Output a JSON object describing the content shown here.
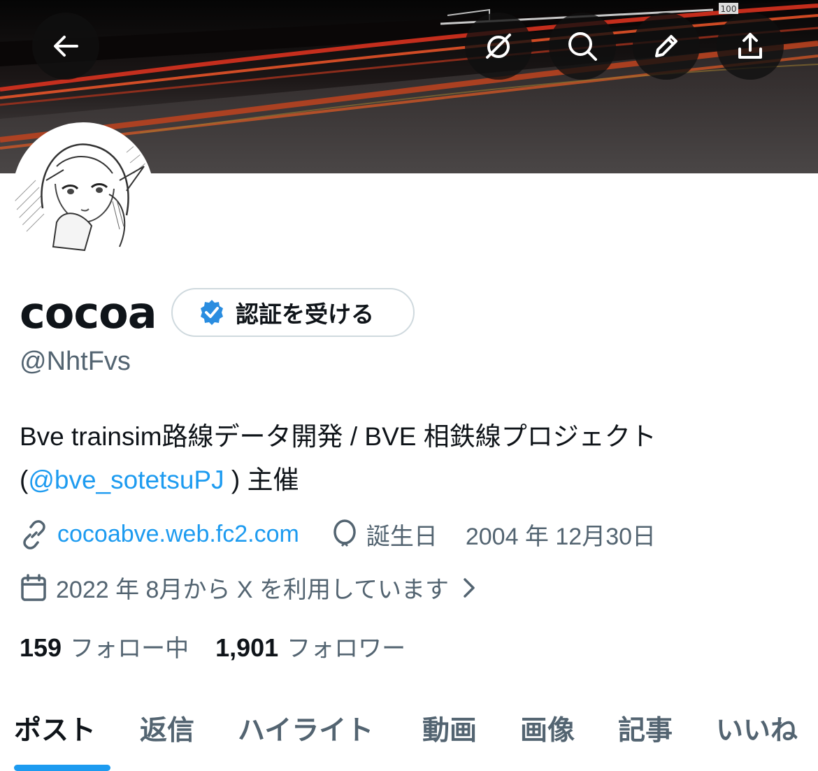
{
  "header": {
    "back_icon": "arrow-left-icon",
    "actions": [
      {
        "name": "grok-icon"
      },
      {
        "name": "search-icon"
      },
      {
        "name": "pencil-icon"
      },
      {
        "name": "share-icon"
      }
    ],
    "banner_sign": "100"
  },
  "profile": {
    "display_name": "cocoa",
    "verify_button_label": "認証を受ける",
    "handle": "@NhtFvs",
    "bio_part1": "Bve trainsim路線データ開発 / BVE 相鉄線プロジェクト",
    "bio_open_paren": "(",
    "bio_mention": "@bve_sotetsuPJ",
    "bio_close": " ) 主催",
    "website": "cocoabve.web.fc2.com",
    "birthday_label": "誕生日",
    "birthday_value": "2004 年 12月30日",
    "joined": "2022 年 8月から X を利用しています",
    "following_count": "159",
    "following_label": "フォロー中",
    "followers_count": "1,901",
    "followers_label": "フォロワー"
  },
  "tabs": [
    {
      "label": "ポスト",
      "active": true
    },
    {
      "label": "返信",
      "active": false
    },
    {
      "label": "ハイライト",
      "active": false
    },
    {
      "label": "動画",
      "active": false
    },
    {
      "label": "画像",
      "active": false
    },
    {
      "label": "記事",
      "active": false
    },
    {
      "label": "いいね",
      "active": false
    }
  ],
  "colors": {
    "accent": "#1d9bf0",
    "text_primary": "#0f1419",
    "text_secondary": "#536471",
    "verified_badge": "#2a8de0"
  }
}
